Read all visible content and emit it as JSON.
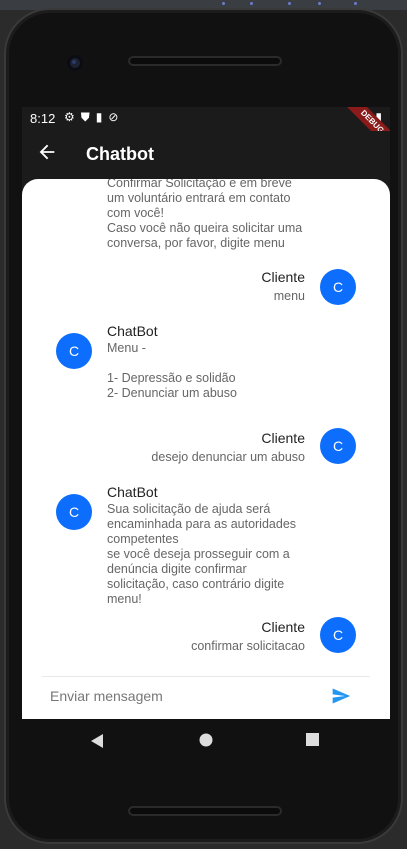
{
  "statusbar": {
    "time": "8:12",
    "debug_label": "DEBUG"
  },
  "appbar": {
    "title": "Chatbot"
  },
  "messages": [
    {
      "sender": "",
      "side": "left",
      "text": "Confirmar Solicitação e em breve\num voluntário entrará em contato\ncom você!\nCaso você não queira solicitar uma\nconversa, por favor, digite menu"
    },
    {
      "sender": "Cliente",
      "side": "right",
      "text": "menu",
      "avatar": "C"
    },
    {
      "sender": "ChatBot",
      "side": "left",
      "text": "Menu -\n\n1- Depressão e solidão\n2- Denunciar um abuso",
      "avatar": "C"
    },
    {
      "sender": "Cliente",
      "side": "right",
      "text": "desejo denunciar um abuso",
      "avatar": "C"
    },
    {
      "sender": "ChatBot",
      "side": "left",
      "text": "Sua solicitação de ajuda será\nencaminhada para as autoridades\ncompetentes\n se você deseja prosseguir com a\ndenúncia digite confirmar\nsolicitação, caso contrário digite\nmenu!",
      "avatar": "C"
    },
    {
      "sender": "Cliente",
      "side": "right",
      "text": "confirmar solicitacao",
      "avatar": "C"
    }
  ],
  "input": {
    "placeholder": "Enviar mensagem"
  },
  "colors": {
    "accent": "#0d6efd",
    "send": "#2196f3"
  }
}
